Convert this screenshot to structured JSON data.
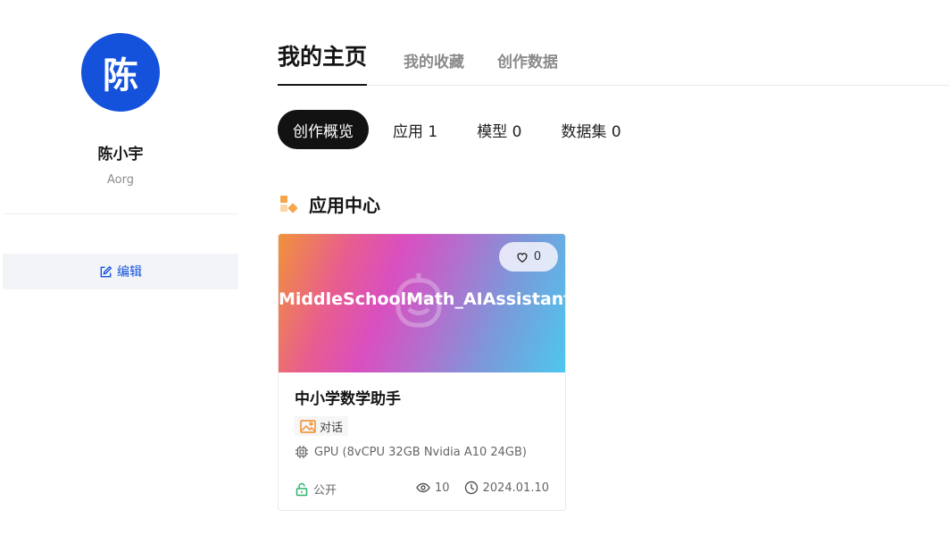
{
  "sidebar": {
    "avatar_char": "陈",
    "user_name": "陈小宇",
    "org": "Aorg",
    "edit_label": "编辑"
  },
  "main_tabs": [
    {
      "label": "我的主页",
      "active": true
    },
    {
      "label": "我的收藏",
      "active": false
    },
    {
      "label": "创作数据",
      "active": false
    }
  ],
  "sub_tabs": [
    {
      "label": "创作概览",
      "active": true
    },
    {
      "label": "应用 1",
      "active": false
    },
    {
      "label": "模型 0",
      "active": false
    },
    {
      "label": "数据集 0",
      "active": false
    }
  ],
  "section": {
    "title": "应用中心",
    "icon": "app-center-icon"
  },
  "cards": [
    {
      "banner_title": "MiddleSchoolMath_AIAssistant",
      "likes": "0",
      "title": "中小学数学助手",
      "tag": "对话",
      "spec": "GPU (8vCPU 32GB Nvidia A10 24GB)",
      "visibility": "公开",
      "views": "10",
      "date": "2024.01.10"
    }
  ],
  "colors": {
    "accent": "#1452dc",
    "active_tab_bg": "#121212",
    "public_green": "#2db36f",
    "section_icon_orange": "#f5a54a"
  }
}
